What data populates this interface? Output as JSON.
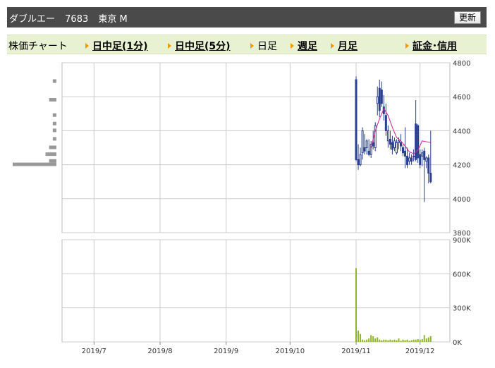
{
  "header": {
    "company": "ダブルエー",
    "code": "7683",
    "market": "東京 M",
    "refresh_label": "更新"
  },
  "nav": {
    "label": "株価チャート",
    "items": [
      {
        "label": "日中足(1分)",
        "link": true
      },
      {
        "label": "日中足(5分)",
        "link": true
      },
      {
        "label": "日足",
        "link": false
      },
      {
        "label": "週足",
        "link": true
      },
      {
        "label": "月足",
        "link": true
      },
      {
        "label": "証金･信用",
        "link": true
      }
    ]
  },
  "colors": {
    "candle": "#2a3f8f",
    "moving_average": "#cc2299",
    "volume": "#8db42a",
    "volume_profile": "#999999",
    "grid": "#cccccc"
  },
  "chart_data": [
    {
      "type": "candlestick",
      "ylim": [
        3800,
        4800
      ],
      "yticks": [
        4800,
        4600,
        4400,
        4200,
        4000,
        3800
      ],
      "xtick_labels": [
        "2019/7",
        "2019/8",
        "2019/9",
        "2019/10",
        "2019/11",
        "2019/12"
      ],
      "xtick_days": [
        0,
        31,
        62,
        92,
        123,
        153
      ],
      "xlim_days": [
        -15,
        167
      ],
      "grid": true,
      "candles": [
        {
          "day": 123,
          "o": 4700,
          "h": 4720,
          "l": 4220,
          "c": 4230
        },
        {
          "day": 124,
          "o": 4230,
          "h": 4320,
          "l": 4170,
          "c": 4200
        },
        {
          "day": 125,
          "o": 4200,
          "h": 4300,
          "l": 4190,
          "c": 4260
        },
        {
          "day": 126,
          "o": 4270,
          "h": 4420,
          "l": 4230,
          "c": 4400
        },
        {
          "day": 127,
          "o": 4300,
          "h": 4380,
          "l": 4260,
          "c": 4280
        },
        {
          "day": 128,
          "o": 4300,
          "h": 4350,
          "l": 4260,
          "c": 4340
        },
        {
          "day": 129,
          "o": 4280,
          "h": 4350,
          "l": 4250,
          "c": 4260
        },
        {
          "day": 130,
          "o": 4260,
          "h": 4340,
          "l": 4240,
          "c": 4320
        },
        {
          "day": 131,
          "o": 4330,
          "h": 4400,
          "l": 4290,
          "c": 4310
        },
        {
          "day": 132,
          "o": 4300,
          "h": 4450,
          "l": 4280,
          "c": 4430
        },
        {
          "day": 133,
          "o": 4560,
          "h": 4660,
          "l": 4490,
          "c": 4600
        },
        {
          "day": 134,
          "o": 4650,
          "h": 4700,
          "l": 4480,
          "c": 4520
        },
        {
          "day": 135,
          "o": 4640,
          "h": 4690,
          "l": 4540,
          "c": 4560
        },
        {
          "day": 136,
          "o": 4540,
          "h": 4610,
          "l": 4460,
          "c": 4500
        },
        {
          "day": 137,
          "o": 4490,
          "h": 4560,
          "l": 4370,
          "c": 4400
        },
        {
          "day": 138,
          "o": 4340,
          "h": 4430,
          "l": 4300,
          "c": 4400
        },
        {
          "day": 139,
          "o": 4350,
          "h": 4400,
          "l": 4290,
          "c": 4320
        },
        {
          "day": 140,
          "o": 4330,
          "h": 4370,
          "l": 4260,
          "c": 4290
        },
        {
          "day": 141,
          "o": 4300,
          "h": 4360,
          "l": 4280,
          "c": 4340
        },
        {
          "day": 142,
          "o": 4270,
          "h": 4350,
          "l": 4260,
          "c": 4330
        },
        {
          "day": 143,
          "o": 4330,
          "h": 4360,
          "l": 4290,
          "c": 4340
        },
        {
          "day": 144,
          "o": 4330,
          "h": 4380,
          "l": 4280,
          "c": 4310
        },
        {
          "day": 145,
          "o": 4300,
          "h": 4320,
          "l": 4250,
          "c": 4270
        },
        {
          "day": 146,
          "o": 4280,
          "h": 4420,
          "l": 4180,
          "c": 4250
        },
        {
          "day": 147,
          "o": 4250,
          "h": 4300,
          "l": 4180,
          "c": 4200
        },
        {
          "day": 148,
          "o": 4220,
          "h": 4270,
          "l": 4200,
          "c": 4240
        },
        {
          "day": 149,
          "o": 4240,
          "h": 4260,
          "l": 4200,
          "c": 4220
        },
        {
          "day": 150,
          "o": 4250,
          "h": 4290,
          "l": 4220,
          "c": 4250
        },
        {
          "day": 151,
          "o": 4440,
          "h": 4580,
          "l": 4220,
          "c": 4230
        },
        {
          "day": 152,
          "o": 4430,
          "h": 4440,
          "l": 4210,
          "c": 4240
        },
        {
          "day": 153,
          "o": 4260,
          "h": 4290,
          "l": 4180,
          "c": 4200
        },
        {
          "day": 154,
          "o": 4250,
          "h": 4290,
          "l": 4190,
          "c": 4270
        },
        {
          "day": 155,
          "o": 4280,
          "h": 4300,
          "l": 3980,
          "c": 4230
        },
        {
          "day": 156,
          "o": 4220,
          "h": 4250,
          "l": 4180,
          "c": 4240
        },
        {
          "day": 157,
          "o": 4240,
          "h": 4260,
          "l": 4090,
          "c": 4150
        },
        {
          "day": 158,
          "o": 4150,
          "h": 4400,
          "l": 4090,
          "c": 4100
        }
      ],
      "moving_average": [
        {
          "day": 130,
          "v": 4300
        },
        {
          "day": 132,
          "v": 4400
        },
        {
          "day": 134,
          "v": 4470
        },
        {
          "day": 136,
          "v": 4530
        },
        {
          "day": 138,
          "v": 4490
        },
        {
          "day": 140,
          "v": 4420
        },
        {
          "day": 142,
          "v": 4360
        },
        {
          "day": 144,
          "v": 4340
        },
        {
          "day": 146,
          "v": 4310
        },
        {
          "day": 148,
          "v": 4275
        },
        {
          "day": 150,
          "v": 4265
        },
        {
          "day": 152,
          "v": 4285
        },
        {
          "day": 154,
          "v": 4340
        },
        {
          "day": 156,
          "v": 4335
        },
        {
          "day": 158,
          "v": 4330
        }
      ],
      "volume_profile": [
        {
          "price": 4690,
          "size": 1
        },
        {
          "price": 4580,
          "size": 2
        },
        {
          "price": 4490,
          "size": 1
        },
        {
          "price": 4440,
          "size": 1
        },
        {
          "price": 4400,
          "size": 1
        },
        {
          "price": 4350,
          "size": 1
        },
        {
          "price": 4300,
          "size": 2
        },
        {
          "price": 4260,
          "size": 3
        },
        {
          "price": 4220,
          "size": 2
        },
        {
          "price": 4200,
          "size": 12
        }
      ]
    },
    {
      "type": "bar",
      "ylim": [
        0,
        900000
      ],
      "ytick_values": [
        0,
        300000,
        600000,
        900000
      ],
      "ytick_labels": [
        "0K",
        "300K",
        "600K",
        "900K"
      ],
      "grid": true,
      "bars": [
        {
          "day": 123,
          "v": 650000
        },
        {
          "day": 124,
          "v": 100000
        },
        {
          "day": 125,
          "v": 70000
        },
        {
          "day": 126,
          "v": 20000
        },
        {
          "day": 127,
          "v": 15000
        },
        {
          "day": 128,
          "v": 20000
        },
        {
          "day": 129,
          "v": 30000
        },
        {
          "day": 130,
          "v": 60000
        },
        {
          "day": 131,
          "v": 50000
        },
        {
          "day": 132,
          "v": 30000
        },
        {
          "day": 133,
          "v": 40000
        },
        {
          "day": 134,
          "v": 20000
        },
        {
          "day": 135,
          "v": 15000
        },
        {
          "day": 136,
          "v": 20000
        },
        {
          "day": 137,
          "v": 20000
        },
        {
          "day": 138,
          "v": 15000
        },
        {
          "day": 139,
          "v": 20000
        },
        {
          "day": 140,
          "v": 15000
        },
        {
          "day": 141,
          "v": 20000
        },
        {
          "day": 142,
          "v": 15000
        },
        {
          "day": 143,
          "v": 30000
        },
        {
          "day": 144,
          "v": 10000
        },
        {
          "day": 145,
          "v": 20000
        },
        {
          "day": 146,
          "v": 15000
        },
        {
          "day": 147,
          "v": 20000
        },
        {
          "day": 148,
          "v": 10000
        },
        {
          "day": 149,
          "v": 15000
        },
        {
          "day": 150,
          "v": 20000
        },
        {
          "day": 151,
          "v": 20000
        },
        {
          "day": 152,
          "v": 25000
        },
        {
          "day": 153,
          "v": 20000
        },
        {
          "day": 154,
          "v": 25000
        },
        {
          "day": 155,
          "v": 60000
        },
        {
          "day": 156,
          "v": 30000
        },
        {
          "day": 157,
          "v": 40000
        },
        {
          "day": 158,
          "v": 50000
        }
      ]
    }
  ]
}
